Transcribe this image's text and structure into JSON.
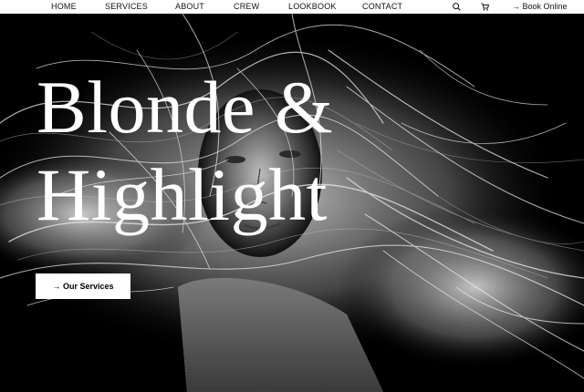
{
  "nav": {
    "items": [
      {
        "label": "HOME"
      },
      {
        "label": "SERVICES"
      },
      {
        "label": "ABOUT"
      },
      {
        "label": "CREW"
      },
      {
        "label": "LOOKBOOK"
      },
      {
        "label": "CONTACT"
      }
    ],
    "search_icon": "search-icon",
    "cart_icon": "cart-icon",
    "book_label": "→ Book Online"
  },
  "hero": {
    "title_line1": "Blonde &",
    "title_line2": "Highlight",
    "cta_label": "→ Our Services",
    "image": "black-and-white photo of woman with windblown blonde hair"
  },
  "colors": {
    "nav_bg": "#ffffff",
    "hero_bg": "#000000",
    "title": "#ffffff",
    "cta_bg": "#ffffff",
    "cta_text": "#000000"
  }
}
